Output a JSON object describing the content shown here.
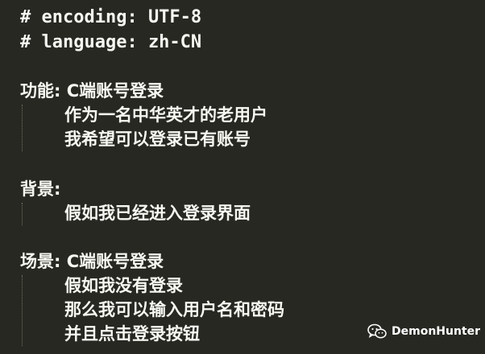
{
  "editor": {
    "header": [
      "# encoding: UTF-8",
      "# language: zh-CN"
    ],
    "feature": {
      "title": "功能: C端账号登录",
      "lines": [
        "作为一名中华英才的老用户",
        "我希望可以登录已有账号"
      ]
    },
    "background": {
      "title": "背景:",
      "lines": [
        "假如我已经进入登录界面"
      ]
    },
    "scenario": {
      "title": "场景: C端账号登录",
      "lines": [
        "假如我没有登录",
        "那么我可以输入用户名和密码",
        "并且点击登录按钮"
      ]
    }
  },
  "watermark": {
    "icon": "wechat-icon",
    "text": "DemonHunter"
  }
}
